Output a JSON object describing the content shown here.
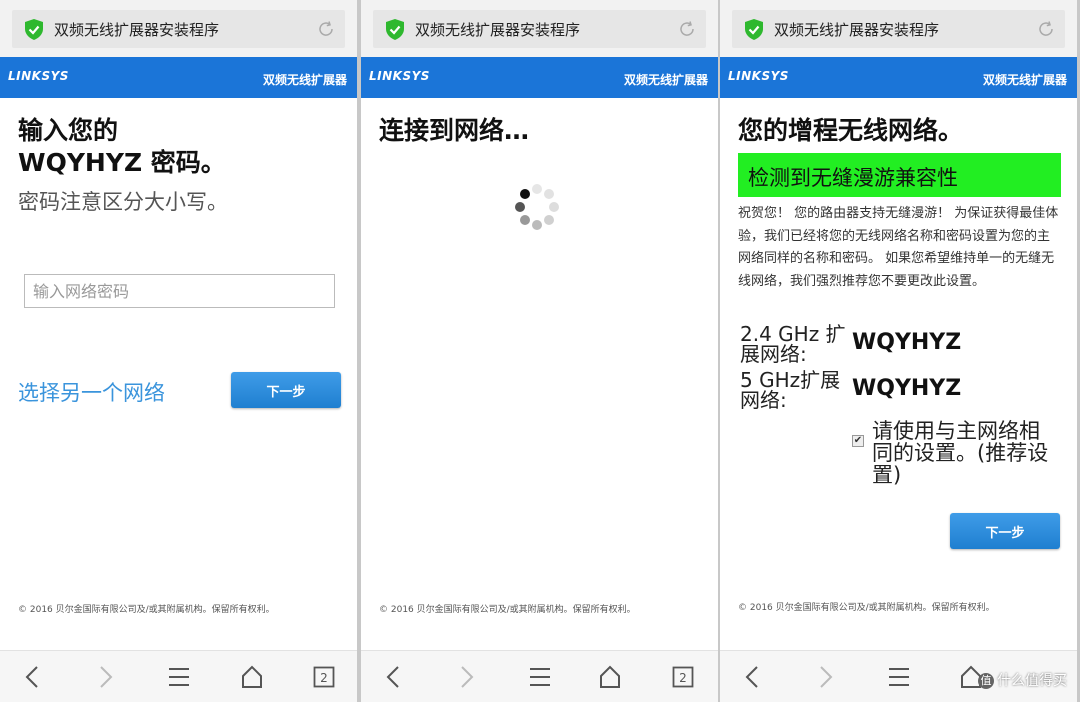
{
  "browser": {
    "tab_title": "双频无线扩展器安装程序",
    "nav_tab_count": "2"
  },
  "header": {
    "logo": "LINKSYS",
    "title": "双频无线扩展器"
  },
  "page1": {
    "heading_line1": "输入您的",
    "heading_line2": "WQYHYZ 密码。",
    "subheading": "密码注意区分大小写。",
    "password_placeholder": "输入网络密码",
    "password_value": "",
    "other_network_link": "选择另一个网络",
    "next_button": "下一步",
    "copyright": "© 2016 贝尔金国际有限公司及/或其附属机构。保留所有权利。"
  },
  "page2": {
    "heading": "连接到网络…",
    "copyright": "© 2016 贝尔金国际有限公司及/或其附属机构。保留所有权利。"
  },
  "page3": {
    "heading": "您的增程无线网络。",
    "banner": "检测到无缝漫游兼容性",
    "banner_color": "#22ee22",
    "paragraph": "祝贺您！ 您的路由器支持无缝漫游！ 为保证获得最佳体验，我们已经将您的无线网络名称和密码设置为您的主网络同样的名称和密码。 如果您希望维持单一的无缝无线网络，我们强烈推荐您不要更改此设置。",
    "network_24_label": "2.4 GHz 扩展网络:",
    "network_24_value": "WQYHYZ",
    "network_5_label": "5 GHz扩展网络:",
    "network_5_value": "WQYHYZ",
    "same_settings_checked": true,
    "same_settings_label": "请使用与主网络相同的设置。(推荐设置)",
    "next_button": "下一步",
    "copyright": "© 2016 贝尔金国际有限公司及/或其附属机构。保留所有权利。"
  },
  "watermark": {
    "icon": "值",
    "text": "什么值得买"
  },
  "colors": {
    "linksys_blue": "#1b75d8",
    "button_blue": "#2a8ad9",
    "link_blue": "#3a94dc",
    "shield_green": "#2eb82e"
  }
}
